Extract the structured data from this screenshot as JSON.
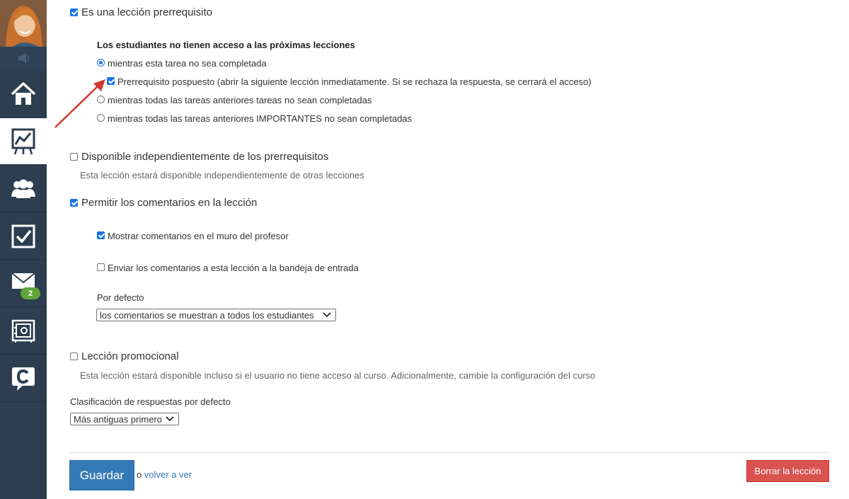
{
  "sidebar": {
    "items": [
      {
        "icon": "home-icon"
      },
      {
        "icon": "chart-board-icon",
        "active": true
      },
      {
        "icon": "users-icon"
      },
      {
        "icon": "checkbox-task-icon"
      },
      {
        "icon": "mail-icon",
        "badge": "2"
      },
      {
        "icon": "safe-icon"
      },
      {
        "icon": "chat-logo-icon"
      }
    ]
  },
  "prereq": {
    "label": "Es una lección prerrequisito",
    "checked": true,
    "heading": "Los estudiantes no tienen acceso a las próximas lecciones",
    "option1": "mientras esta tarea no sea completada",
    "postponed": "Prerrequisito pospuesto (abrir la siguiente lección inmediatamente. Si se rechaza la respuesta, se cerrará el acceso)",
    "option2": "mientras todas las tareas anteriores tareas no sean completadas",
    "option3": "mientras todas las tareas anteriores IMPORTANTES no sean completadas"
  },
  "independent": {
    "label": "Disponible independientemente de los prerrequisitos",
    "description": "Esta lección estará disponible independientemente de otras lecciones"
  },
  "comments": {
    "label": "Permitir los comentarios en la lección",
    "show_on_wall": "Mostrar comentarios en el muro del profesor",
    "send_inbox": "Enviar los comentarios a esta lección a la bandeja de entrada",
    "default_label": "Por defecto",
    "default_value": "los comentarios se muestran a todos los estudiantes"
  },
  "promo": {
    "label": "Lección promocional",
    "description": "Esta lección estará disponible incluso si el usuario no tiene acceso al curso. Adicionalmente, cambie la configuración del curso"
  },
  "sorting": {
    "label": "Clasificación de respuestas por defecto",
    "value": "Más antiguas primero"
  },
  "footer": {
    "save": "Guardar",
    "or": "o",
    "back": "volver a ver",
    "delete": "Borrar la lección"
  },
  "colors": {
    "sidebar": "#2c3e50",
    "primary": "#337ab7",
    "danger": "#d9534f",
    "badge": "#5fa63a",
    "arrow": "#d0382b"
  }
}
